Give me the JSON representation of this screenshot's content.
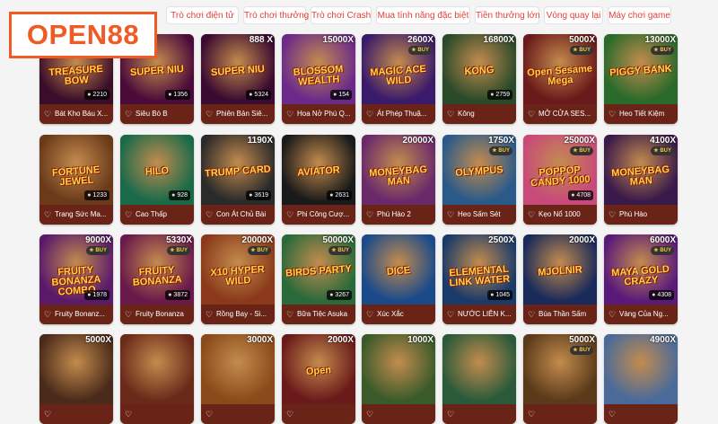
{
  "logo": {
    "text": "OPEN88"
  },
  "tabs": [
    {
      "label": "Trò chơi điện tử"
    },
    {
      "label": "Trò chơi thưởng"
    },
    {
      "label": "Trò chơi Crash"
    },
    {
      "label": "Mua tính năng đặc biệt"
    },
    {
      "label": "Tiền thưởng lớn"
    },
    {
      "label": "Vòng quay lại"
    },
    {
      "label": "Máy chơi game"
    }
  ],
  "colors": {
    "accent": "#e0413b",
    "brand": "#f05a24",
    "card_caption": "#6a2417"
  },
  "games": [
    {
      "art": "TREASURE BOW",
      "mult": "",
      "buy": false,
      "players": "2210",
      "name": "Bát Kho Báu X...",
      "bg": "#3a0d2a"
    },
    {
      "art": "SUPER NIU",
      "mult": "",
      "buy": false,
      "players": "1356",
      "name": "Siêu Bò B",
      "bg": "#4a0a3a"
    },
    {
      "art": "SUPER NIU",
      "mult": "888 X",
      "buy": false,
      "players": "5324",
      "name": "Phiên Bản Siê...",
      "bg": "#3a0a30"
    },
    {
      "art": "BLOSSOM WEALTH",
      "mult": "15000X",
      "buy": false,
      "players": "154",
      "name": "Hoa Nở Phú Q...",
      "bg": "#6b2a8a"
    },
    {
      "art": "MAGIC ACE WILD",
      "mult": "2600X",
      "buy": true,
      "players": "",
      "name": "Át Phép Thuậ...",
      "bg": "#3a1a6a"
    },
    {
      "art": "KONG",
      "mult": "16800X",
      "buy": false,
      "players": "2759",
      "name": "Kông",
      "bg": "#2a4a2a"
    },
    {
      "art": "Open Sesame Mega",
      "mult": "5000X",
      "buy": true,
      "players": "",
      "name": "MỞ CỬA SES...",
      "bg": "#6a1a1a"
    },
    {
      "art": "PIGGY BANK",
      "mult": "13000X",
      "buy": true,
      "players": "",
      "name": "Heo Tiết Kiệm",
      "bg": "#2a6a2a"
    },
    {
      "art": "FORTUNE JEWEL",
      "mult": "",
      "buy": false,
      "players": "1233",
      "name": "Trang Sức Ma...",
      "bg": "#6a3a1a"
    },
    {
      "art": "HILO",
      "mult": "",
      "buy": false,
      "players": "928",
      "name": "Cao Thấp",
      "bg": "#1a6a4a"
    },
    {
      "art": "TRUMP CARD",
      "mult": "1190X",
      "buy": false,
      "players": "3619",
      "name": "Con Át Chủ Bài",
      "bg": "#2a2a2a"
    },
    {
      "art": "AVIATOR",
      "mult": "",
      "buy": false,
      "players": "2631",
      "name": "Phi Công Cượ...",
      "bg": "#1a1a1a"
    },
    {
      "art": "MONEYBAG MAN",
      "mult": "20000X",
      "buy": false,
      "players": "",
      "name": "Phú Hào 2",
      "bg": "#6a2a6a"
    },
    {
      "art": "OLYMPUS",
      "mult": "1750X",
      "buy": true,
      "players": "",
      "name": "Heo Sấm Sét",
      "bg": "#2a5a8a"
    },
    {
      "art": "POPPOP CANDY 1000",
      "mult": "25000X",
      "buy": true,
      "players": "4708",
      "name": "Kẹo Nổ 1000",
      "bg": "#c84a7a"
    },
    {
      "art": "MONEYBAG MAN",
      "mult": "4100X",
      "buy": true,
      "players": "",
      "name": "Phú Hào",
      "bg": "#3a1a4a"
    },
    {
      "art": "FRUITY BONANZA COMBO",
      "mult": "9000X",
      "buy": true,
      "players": "1978",
      "name": "Fruity Bonanz...",
      "bg": "#5a1a6a"
    },
    {
      "art": "FRUITY BONANZA",
      "mult": "5330X",
      "buy": true,
      "players": "3872",
      "name": "Fruity Bonanza",
      "bg": "#6a1a4a"
    },
    {
      "art": "X10 HYPER WILD",
      "mult": "20000X",
      "buy": true,
      "players": "",
      "name": "Rồng Bay - Si...",
      "bg": "#8a3a1a"
    },
    {
      "art": "BIRDS PARTY",
      "mult": "50000X",
      "buy": true,
      "players": "3267",
      "name": "Bữa Tiệc Asuka",
      "bg": "#2a6a3a"
    },
    {
      "art": "DICE",
      "mult": "",
      "buy": false,
      "players": "",
      "name": "Xúc Xắc",
      "bg": "#1a4a8a"
    },
    {
      "art": "ELEMENTAL LINK WATER",
      "mult": "2500X",
      "buy": false,
      "players": "1045",
      "name": "NƯỚC LIÊN K...",
      "bg": "#1a3a6a"
    },
    {
      "art": "MJOLNIR",
      "mult": "2000X",
      "buy": false,
      "players": "",
      "name": "Búa Thần Sấm",
      "bg": "#1a2a5a"
    },
    {
      "art": "MAYA GOLD CRAZY",
      "mult": "6000X",
      "buy": true,
      "players": "4308",
      "name": "Vàng Của Ng...",
      "bg": "#5a1a7a"
    },
    {
      "art": "",
      "mult": "5000X",
      "buy": false,
      "players": "",
      "name": "",
      "bg": "#4a2a1a"
    },
    {
      "art": "",
      "mult": "",
      "buy": false,
      "players": "",
      "name": "",
      "bg": "#6a2a1a"
    },
    {
      "art": "",
      "mult": "3000X",
      "buy": false,
      "players": "",
      "name": "",
      "bg": "#8a4a1a"
    },
    {
      "art": "Open",
      "mult": "2000X",
      "buy": false,
      "players": "",
      "name": "",
      "bg": "#6a1a1a"
    },
    {
      "art": "",
      "mult": "1000X",
      "buy": false,
      "players": "",
      "name": "",
      "bg": "#3a5a2a"
    },
    {
      "art": "",
      "mult": "",
      "buy": false,
      "players": "",
      "name": "",
      "bg": "#2a5a3a"
    },
    {
      "art": "",
      "mult": "5000X",
      "buy": true,
      "players": "",
      "name": "",
      "bg": "#5a3a1a"
    },
    {
      "art": "",
      "mult": "4900X",
      "buy": false,
      "players": "",
      "name": "",
      "bg": "#4a6a9a"
    }
  ]
}
